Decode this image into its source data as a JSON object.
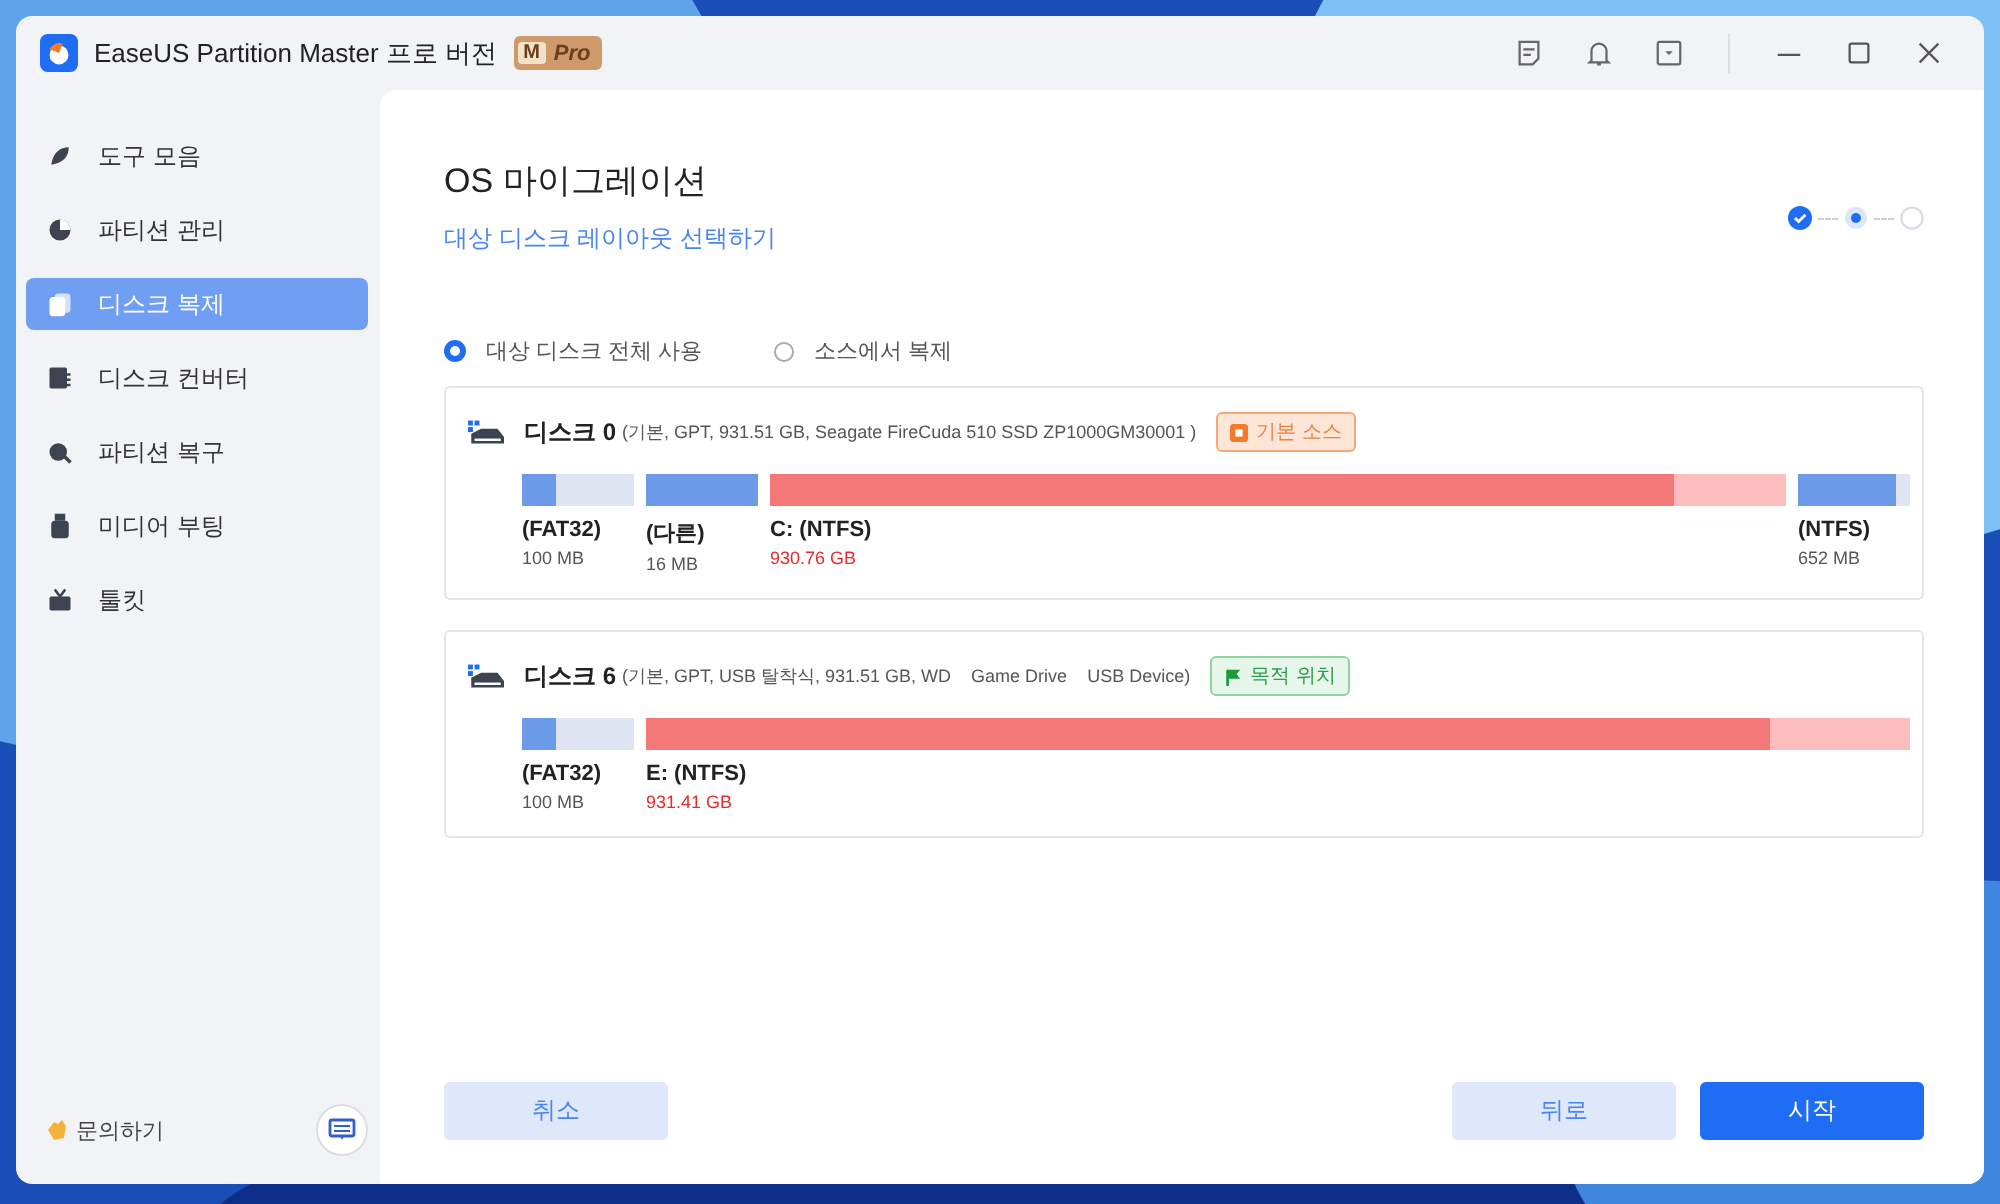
{
  "window": {
    "title": "EaseUS Partition Master 프로 버전",
    "badge": {
      "letter": "M",
      "label": "Pro"
    }
  },
  "sidebar": {
    "items": [
      {
        "label": "도구 모음",
        "selected": false
      },
      {
        "label": "파티션 관리",
        "selected": false
      },
      {
        "label": "디스크 복제",
        "selected": true
      },
      {
        "label": "디스크 컨버터",
        "selected": false
      },
      {
        "label": "파티션 복구",
        "selected": false
      },
      {
        "label": "미디어 부팅",
        "selected": false
      },
      {
        "label": "툴킷",
        "selected": false
      }
    ],
    "contact": "문의하기"
  },
  "page": {
    "title": "OS 마이그레이션",
    "subtitle": "대상 디스크 레이아웃 선택하기",
    "steps": [
      {
        "done": true,
        "selected": false
      },
      {
        "done": false,
        "selected": true
      },
      {
        "done": false,
        "selected": false
      }
    ],
    "options": [
      {
        "label": "대상 디스크 전체 사용",
        "selected": true
      },
      {
        "label": "소스에서 복제",
        "selected": false
      }
    ],
    "disks": [
      {
        "name": "디스크 0",
        "details": "(기본, GPT, 931.51 GB, Seagate FireCuda 510 SSD ZP1000GM30001 )",
        "tag": {
          "kind": "source",
          "label": "기본 소스"
        },
        "partitions": [
          {
            "kind": "system",
            "label": "(FAT32)",
            "size": "100 MB",
            "level": 0.3
          },
          {
            "kind": "system",
            "label": "(다른)",
            "size": "16 MB",
            "level": 1
          },
          {
            "kind": "data",
            "label": "C: (NTFS)",
            "size": "930.76 GB",
            "level": 0.89
          },
          {
            "kind": "system",
            "label": "(NTFS)",
            "size": "652 MB",
            "level": 0.87
          }
        ]
      },
      {
        "name": "디스크 6",
        "details": "(기본, GPT, USB 탈착식, 931.51 GB, WD    Game Drive    USB Device)",
        "tag": {
          "kind": "target",
          "label": "목적 위치"
        },
        "partitions": [
          {
            "kind": "system",
            "label": "(FAT32)",
            "size": "100 MB",
            "level": 0.3
          },
          {
            "kind": "data",
            "label": "E: (NTFS)",
            "size": "931.41 GB",
            "level": 0.89
          }
        ]
      }
    ],
    "buttons": [
      {
        "kind": "secondary",
        "label": "취소"
      },
      {
        "kind": "secondary",
        "label": "뒤로"
      },
      {
        "kind": "primary",
        "label": "시작"
      }
    ]
  }
}
